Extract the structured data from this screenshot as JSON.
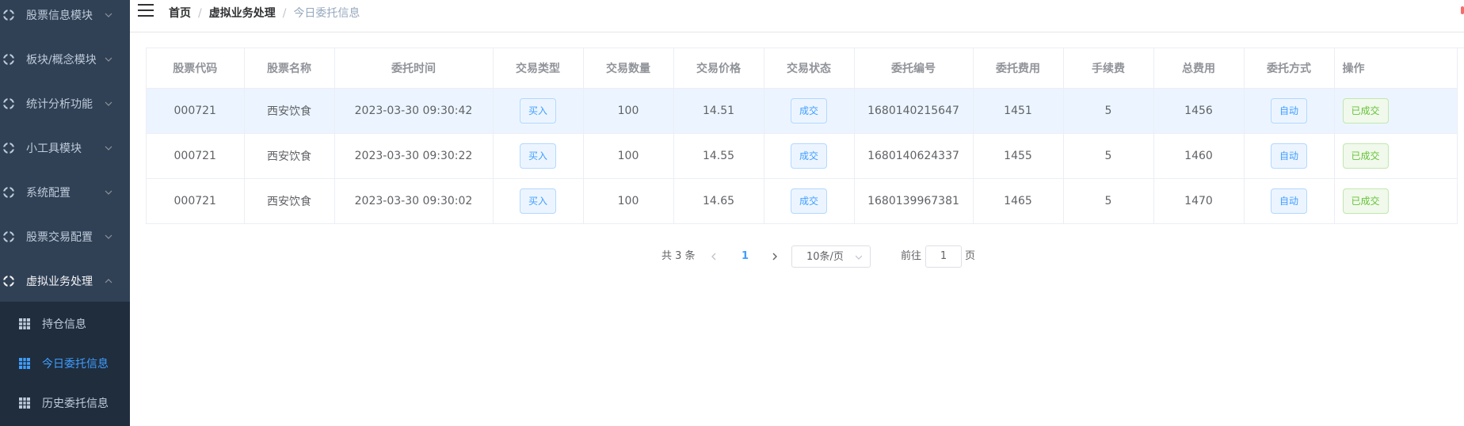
{
  "sidebar": {
    "menus": [
      {
        "label": "股票信息模块",
        "icon": "module-icon",
        "expanded": false
      },
      {
        "label": "板块/概念模块",
        "icon": "module-icon",
        "expanded": false
      },
      {
        "label": "统计分析功能",
        "icon": "module-icon",
        "expanded": false
      },
      {
        "label": "小工具模块",
        "icon": "module-icon",
        "expanded": false
      },
      {
        "label": "系统配置",
        "icon": "module-icon",
        "expanded": false
      },
      {
        "label": "股票交易配置",
        "icon": "module-icon",
        "expanded": false
      },
      {
        "label": "虚拟业务处理",
        "icon": "module-icon",
        "expanded": true
      }
    ],
    "submenu": [
      {
        "label": "持仓信息",
        "icon": "grid-icon",
        "active": false
      },
      {
        "label": "今日委托信息",
        "icon": "grid-icon",
        "active": true
      },
      {
        "label": "历史委托信息",
        "icon": "grid-icon",
        "active": false
      }
    ]
  },
  "breadcrumb": {
    "items": [
      "首页",
      "虚拟业务处理",
      "今日委托信息"
    ],
    "separator": "/"
  },
  "table": {
    "columns": [
      "股票代码",
      "股票名称",
      "委托时间",
      "交易类型",
      "交易数量",
      "交易价格",
      "交易状态",
      "委托编号",
      "委托费用",
      "手续费",
      "总费用",
      "委托方式",
      "操作"
    ],
    "rows": [
      {
        "code": "000721",
        "name": "西安饮食",
        "time": "2023-03-30 09:30:42",
        "type": "买入",
        "qty": "100",
        "price": "14.51",
        "status": "成交",
        "order_no": "1680140215647",
        "order_fee": "1451",
        "commission": "5",
        "total": "1456",
        "method": "自动",
        "action": "已成交"
      },
      {
        "code": "000721",
        "name": "西安饮食",
        "time": "2023-03-30 09:30:22",
        "type": "买入",
        "qty": "100",
        "price": "14.55",
        "status": "成交",
        "order_no": "1680140624337",
        "order_fee": "1455",
        "commission": "5",
        "total": "1460",
        "method": "自动",
        "action": "已成交"
      },
      {
        "code": "000721",
        "name": "西安饮食",
        "time": "2023-03-30 09:30:02",
        "type": "买入",
        "qty": "100",
        "price": "14.65",
        "status": "成交",
        "order_no": "1680139967381",
        "order_fee": "1465",
        "commission": "5",
        "total": "1470",
        "method": "自动",
        "action": "已成交"
      }
    ]
  },
  "pagination": {
    "total": "共 3 条",
    "current_page": "1",
    "page_size": "10条/页",
    "goto_prefix": "前往",
    "goto_value": "1",
    "goto_suffix": "页"
  },
  "colors": {
    "sidebar_bg": "#304156",
    "submenu_bg": "#1f2d3d",
    "accent": "#409eff",
    "success": "#67c23a",
    "row_hover": "#ecf5ff"
  }
}
